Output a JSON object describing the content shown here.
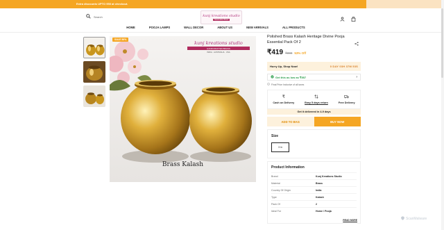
{
  "topbar": {
    "announcement": "Extra discounts UPTO 950 at checkout."
  },
  "header": {
    "search_placeholder": "Search",
    "logo_text": "kunj kreations studio",
    "logo_tagline": "Handcrafted Brass"
  },
  "nav": {
    "items": [
      "HOME",
      "POOJA LAMPS",
      "WALL DECOR",
      "ABOUT US",
      "NEW ARRIVALS",
      "ALL PRODUCTS"
    ]
  },
  "gallery": {
    "sale_badge": "SALE 56%",
    "brand_overlay": "kunj kreations studio",
    "overlay_tag": "HANDCRAFTED BRASS",
    "overlay_countries": "INDIA · AUSTRALIA · USA",
    "caption": "Brass Kalash"
  },
  "product": {
    "title": "Polished Brass Kalash Heritage Divine Pooja Essential Pack Of 2",
    "price": "₹419",
    "mrp": "₹899",
    "discount": "53% Off",
    "hurry_label": "Hurry Up, Shop Now!",
    "timer": "0 DAY 03H 37M 53S",
    "offer": "Get this as low as ₹557",
    "taxes_note": "Final Price Inclusive of all taxes",
    "perks": [
      "Cash on Delivery",
      "Easy 5 days return",
      "Free Delivery"
    ],
    "delivery_note": "Get it delivered in 4-9 days",
    "add_to_bag": "ADD TO BAG",
    "buy_now": "BUY NOW"
  },
  "size": {
    "title": "Size",
    "selected": "3 in"
  },
  "info": {
    "title": "Product Information",
    "rows": [
      {
        "k": "Brand",
        "v": "Kunj Kreations Studio"
      },
      {
        "k": "Material",
        "v": "Brass"
      },
      {
        "k": "Country Of Origin",
        "v": "India"
      },
      {
        "k": "Type",
        "v": "Kalash"
      },
      {
        "k": "Pack Of",
        "v": "2"
      },
      {
        "k": "Ideal For",
        "v": "Home / Pooja"
      }
    ],
    "read_more": "READ MORE"
  },
  "watermark": "ScanMalware",
  "colors": {
    "accent": "#f5a623",
    "accent_light": "#fdf1dc",
    "success": "#2a9d4a"
  }
}
